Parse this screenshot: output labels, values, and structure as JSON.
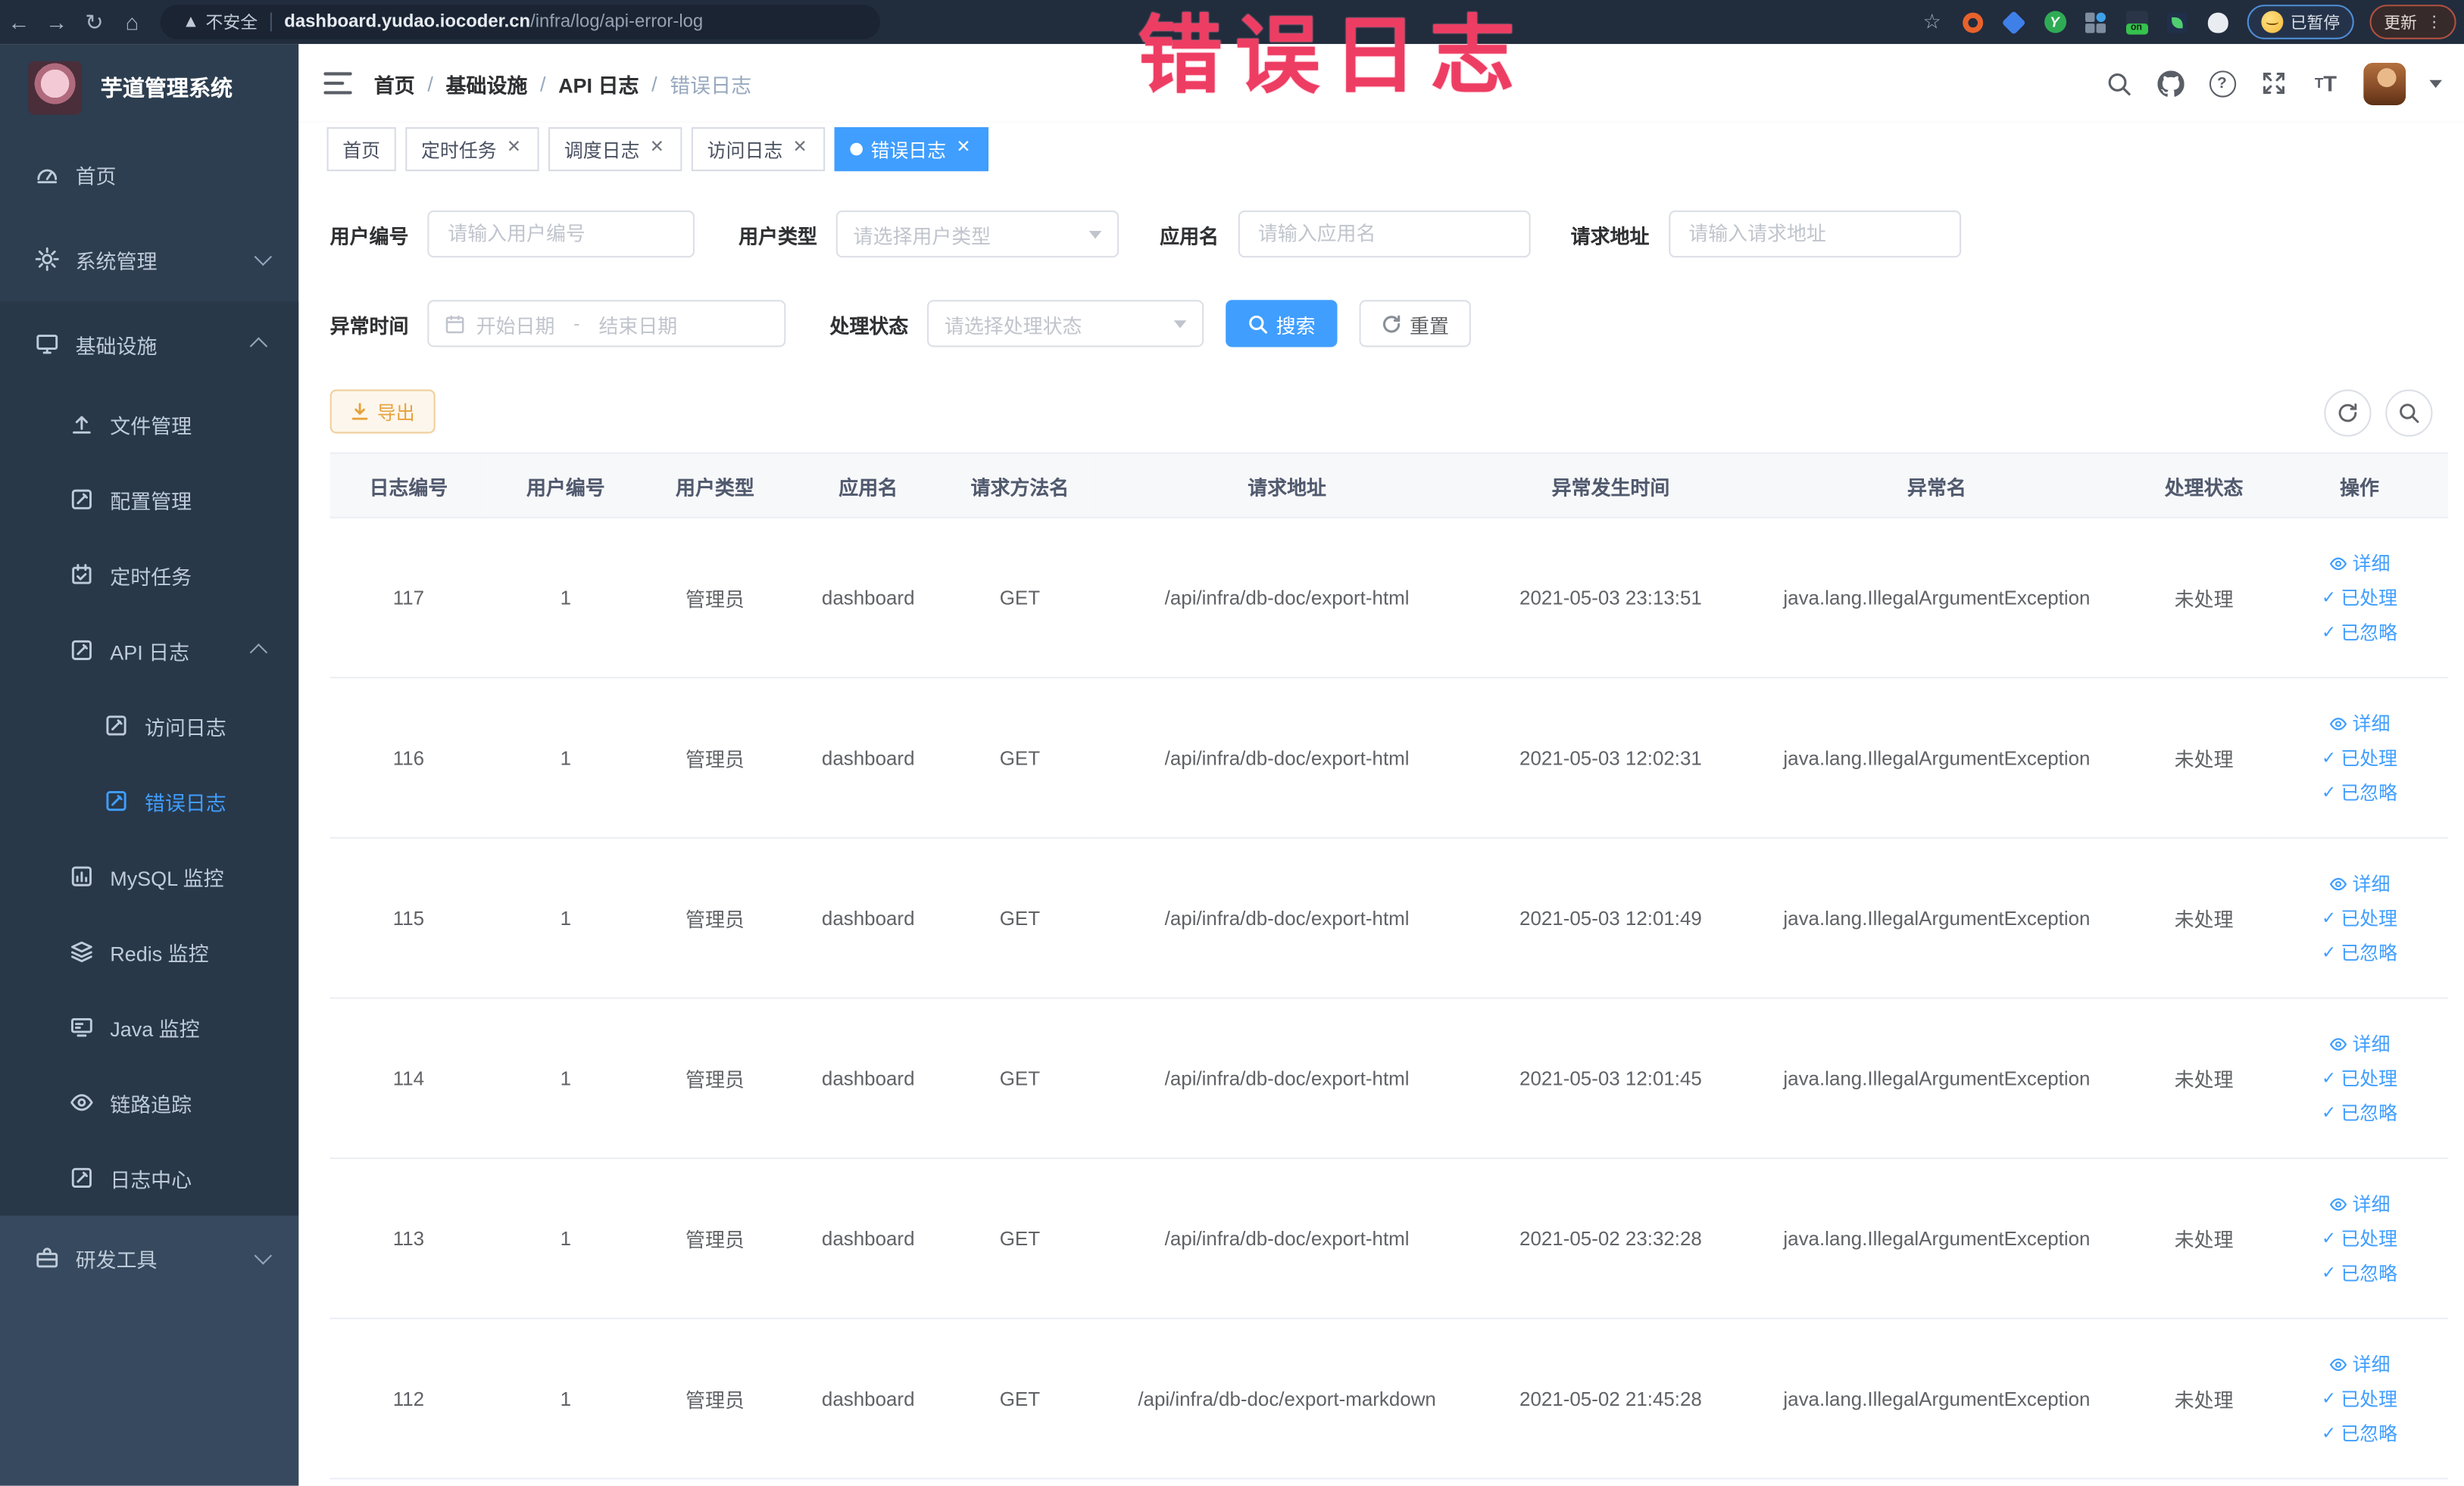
{
  "browser": {
    "security_label": "不安全",
    "url_domain": "dashboard.yudao.iocoder.cn",
    "url_path": "/infra/log/api-error-log",
    "paused_badge": "已暂停",
    "update_label": "更新"
  },
  "overlay_title": "错误日志",
  "sidebar": {
    "logo_title": "芋道管理系统",
    "items": [
      {
        "label": "首页",
        "icon": "gauge-icon"
      },
      {
        "label": "系统管理",
        "icon": "gear-icon",
        "arrow": "down"
      },
      {
        "label": "基础设施",
        "icon": "monitor-icon",
        "arrow": "up"
      },
      {
        "label": "文件管理",
        "icon": "upload-icon"
      },
      {
        "label": "配置管理",
        "icon": "doc-edit-icon"
      },
      {
        "label": "定时任务",
        "icon": "calendar-check-icon"
      },
      {
        "label": "API 日志",
        "icon": "doc-edit-icon",
        "arrow": "up"
      },
      {
        "label": "访问日志",
        "icon": "doc-edit-icon"
      },
      {
        "label": "错误日志",
        "icon": "doc-edit-icon",
        "active": true
      },
      {
        "label": "MySQL 监控",
        "icon": "chart-icon"
      },
      {
        "label": "Redis 监控",
        "icon": "layers-icon"
      },
      {
        "label": "Java 监控",
        "icon": "screen-icon"
      },
      {
        "label": "链路追踪",
        "icon": "eye-icon"
      },
      {
        "label": "日志中心",
        "icon": "doc-edit-icon"
      },
      {
        "label": "研发工具",
        "icon": "toolbox-icon",
        "arrow": "down"
      }
    ]
  },
  "header": {
    "breadcrumb": [
      "首页",
      "基础设施",
      "API 日志",
      "错误日志"
    ],
    "breadcrumb_separator": "/"
  },
  "tabs": [
    {
      "label": "首页"
    },
    {
      "label": "定时任务"
    },
    {
      "label": "调度日志"
    },
    {
      "label": "访问日志"
    },
    {
      "label": "错误日志"
    }
  ],
  "filters": {
    "user_id_label": "用户编号",
    "user_id_placeholder": "请输入用户编号",
    "user_type_label": "用户类型",
    "user_type_placeholder": "请选择用户类型",
    "app_name_label": "应用名",
    "app_name_placeholder": "请输入应用名",
    "request_url_label": "请求地址",
    "request_url_placeholder": "请输入请求地址",
    "time_label": "异常时间",
    "time_start_placeholder": "开始日期",
    "time_separator": "-",
    "time_end_placeholder": "结束日期",
    "status_label": "处理状态",
    "status_placeholder": "请选择处理状态",
    "search_label": "搜索",
    "reset_label": "重置"
  },
  "toolbar": {
    "export_label": "导出"
  },
  "table": {
    "columns": [
      "日志编号",
      "用户编号",
      "用户类型",
      "应用名",
      "请求方法名",
      "请求地址",
      "异常发生时间",
      "异常名",
      "处理状态",
      "操作"
    ],
    "row_actions": [
      "详细",
      "已处理",
      "已忽略"
    ],
    "rows": [
      {
        "id": "117",
        "user_id": "1",
        "user_type": "管理员",
        "app": "dashboard",
        "method": "GET",
        "url": "/api/infra/db-doc/export-html",
        "time": "2021-05-03 23:13:51",
        "exception": "java.lang.IllegalArgumentException",
        "status": "未处理"
      },
      {
        "id": "116",
        "user_id": "1",
        "user_type": "管理员",
        "app": "dashboard",
        "method": "GET",
        "url": "/api/infra/db-doc/export-html",
        "time": "2021-05-03 12:02:31",
        "exception": "java.lang.IllegalArgumentException",
        "status": "未处理"
      },
      {
        "id": "115",
        "user_id": "1",
        "user_type": "管理员",
        "app": "dashboard",
        "method": "GET",
        "url": "/api/infra/db-doc/export-html",
        "time": "2021-05-03 12:01:49",
        "exception": "java.lang.IllegalArgumentException",
        "status": "未处理"
      },
      {
        "id": "114",
        "user_id": "1",
        "user_type": "管理员",
        "app": "dashboard",
        "method": "GET",
        "url": "/api/infra/db-doc/export-html",
        "time": "2021-05-03 12:01:45",
        "exception": "java.lang.IllegalArgumentException",
        "status": "未处理"
      },
      {
        "id": "113",
        "user_id": "1",
        "user_type": "管理员",
        "app": "dashboard",
        "method": "GET",
        "url": "/api/infra/db-doc/export-html",
        "time": "2021-05-02 23:32:28",
        "exception": "java.lang.IllegalArgumentException",
        "status": "未处理"
      },
      {
        "id": "112",
        "user_id": "1",
        "user_type": "管理员",
        "app": "dashboard",
        "method": "GET",
        "url": "/api/infra/db-doc/export-markdown",
        "time": "2021-05-02 21:45:28",
        "exception": "java.lang.IllegalArgumentException",
        "status": "未处理"
      }
    ]
  },
  "colors": {
    "accent": "#409eff",
    "overlay_red": "#ee3d63",
    "warning": "#e6a23c",
    "sidebar_bg": "#2d3e50"
  }
}
